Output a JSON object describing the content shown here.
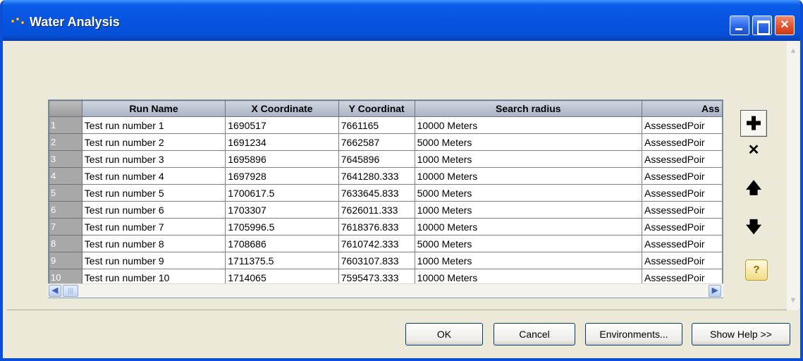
{
  "window": {
    "title": "Water Analysis"
  },
  "grid": {
    "columns": [
      "Run Name",
      "X Coordinate",
      "Y Coordinat",
      "Search radius",
      "Ass"
    ],
    "rows": [
      {
        "num": "1",
        "name": "Test run number 1",
        "x": "1690517",
        "y": "7661165",
        "radius": "10000 Meters",
        "assessed": "AssessedPoir"
      },
      {
        "num": "2",
        "name": "Test run number 2",
        "x": "1691234",
        "y": "7662587",
        "radius": "5000 Meters",
        "assessed": "AssessedPoir"
      },
      {
        "num": "3",
        "name": "Test run number 3",
        "x": "1695896",
        "y": "7645896",
        "radius": "1000 Meters",
        "assessed": "AssessedPoir"
      },
      {
        "num": "4",
        "name": "Test run number 4",
        "x": "1697928",
        "y": "7641280.333",
        "radius": "10000 Meters",
        "assessed": "AssessedPoir"
      },
      {
        "num": "5",
        "name": "Test run number 5",
        "x": "1700617.5",
        "y": "7633645.833",
        "radius": "5000 Meters",
        "assessed": "AssessedPoir"
      },
      {
        "num": "6",
        "name": "Test run number 6",
        "x": "1703307",
        "y": "7626011.333",
        "radius": "1000 Meters",
        "assessed": "AssessedPoir"
      },
      {
        "num": "7",
        "name": "Test run number 7",
        "x": "1705996.5",
        "y": "7618376.833",
        "radius": "10000 Meters",
        "assessed": "AssessedPoir"
      },
      {
        "num": "8",
        "name": "Test run number 8",
        "x": "1708686",
        "y": "7610742.333",
        "radius": "5000 Meters",
        "assessed": "AssessedPoir"
      },
      {
        "num": "9",
        "name": "Test run number 9",
        "x": "1711375.5",
        "y": "7603107.833",
        "radius": "1000 Meters",
        "assessed": "AssessedPoir"
      },
      {
        "num": "10",
        "name": "Test run number 10",
        "x": "1714065",
        "y": "7595473.333",
        "radius": "10000 Meters",
        "assessed": "AssessedPoir"
      }
    ]
  },
  "side_buttons": {
    "add_icon": "plus-icon",
    "delete_icon": "x-icon",
    "up_icon": "arrow-up-icon",
    "down_icon": "arrow-down-icon",
    "help_icon": "question-icon"
  },
  "footer": {
    "ok": "OK",
    "cancel": "Cancel",
    "environments": "Environments...",
    "show_help": "Show Help >>"
  },
  "colors": {
    "titlebar": "#0854e0",
    "window_bg": "#ece9d8",
    "row_header": "#a8a8a8"
  }
}
